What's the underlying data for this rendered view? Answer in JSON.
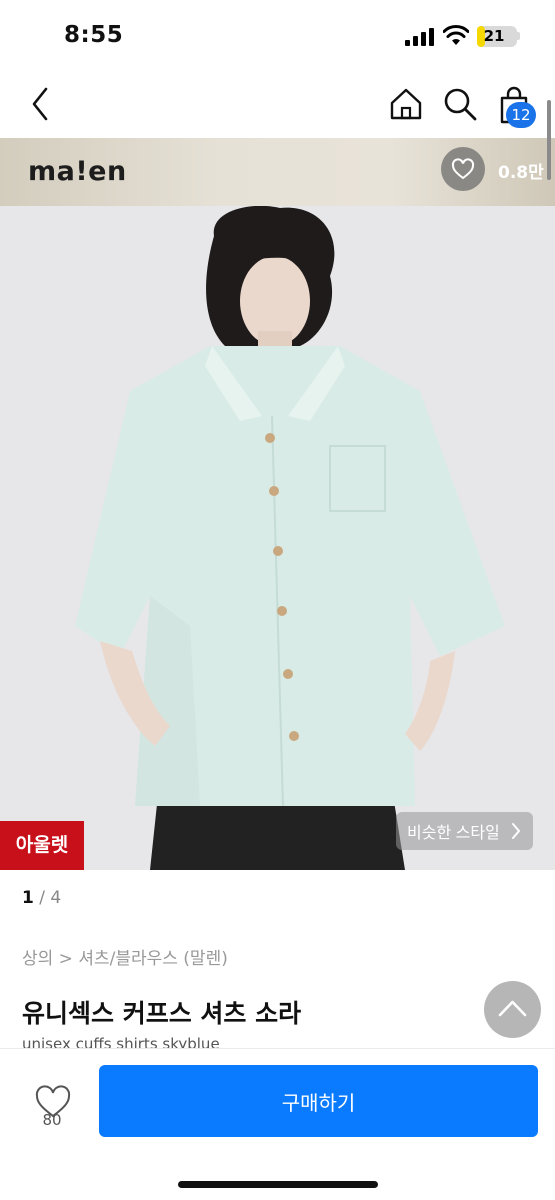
{
  "status_bar": {
    "time": "8:55",
    "battery_level": "21",
    "battery_percent": 21,
    "battery_color": "#f5d800"
  },
  "nav": {
    "back_icon": "chevron-left-icon",
    "home_icon": "home-icon",
    "search_icon": "search-icon",
    "cart_icon": "shopping-bag-icon",
    "cart_count": "12"
  },
  "brand": {
    "name": "ma!en",
    "like_icon": "heart-icon",
    "like_count": "0.8만"
  },
  "gallery": {
    "outlet_badge": "아울렛",
    "similar_style_label": "비슷한 스타일",
    "current_page": "1",
    "separator": "/",
    "total_pages": "4"
  },
  "product": {
    "breadcrumb": "상의 > 셔츠/블라우스 (말렌)",
    "title": "유니섹스 커프스 셔츠 소라",
    "subtitle": "unisex cuffs shirts skyblue"
  },
  "bottom_bar": {
    "wish_icon": "heart-outline-icon",
    "wish_count": "80",
    "buy_label": "구매하기"
  },
  "colors": {
    "primary": "#0a7bff",
    "badge_blue": "#1a73e8",
    "outlet_red": "#c8101a"
  }
}
